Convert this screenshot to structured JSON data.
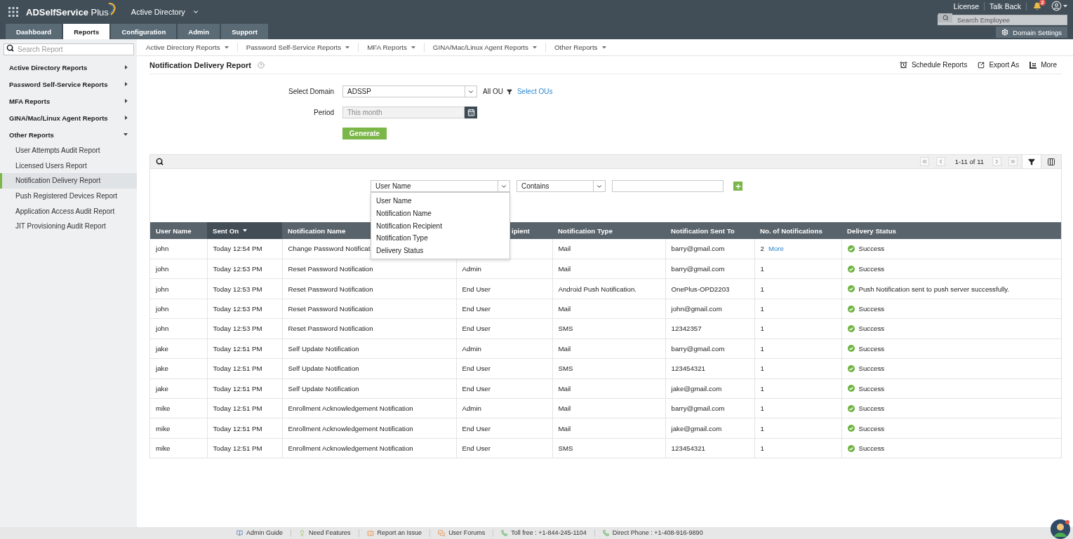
{
  "header": {
    "product_name": "**ADSelfService** Plus",
    "module": "Active Directory",
    "links": [
      "License",
      "Talk Back"
    ],
    "notification_count": "2",
    "employee_search": {
      "placeholder": "Search Employee"
    },
    "domain_settings": "Domain Settings"
  },
  "tabs": [
    {
      "label": "Dashboard",
      "selected": false
    },
    {
      "label": "Reports",
      "selected": true
    },
    {
      "label": "Configuration",
      "selected": false
    },
    {
      "label": "Admin",
      "selected": false
    },
    {
      "label": "Support",
      "selected": false
    }
  ],
  "report_search": {
    "placeholder": "Search Report"
  },
  "report_menu": [
    "Active Directory Reports",
    "Password Self-Service Reports",
    "MFA Reports",
    "GINA/Mac/Linux Agent Reports",
    "Other Reports"
  ],
  "sidebar": {
    "items": [
      {
        "label": "Active Directory Reports",
        "expanded": false
      },
      {
        "label": "Password Self-Service Reports",
        "expanded": false
      },
      {
        "label": "MFA Reports",
        "expanded": false
      },
      {
        "label": "GINA/Mac/Linux Agent Reports",
        "expanded": false
      },
      {
        "label": "Other Reports",
        "expanded": true,
        "children": [
          {
            "label": "User Attempts Audit Report",
            "selected": false
          },
          {
            "label": "Licensed Users Report",
            "selected": false
          },
          {
            "label": "Notification Delivery Report",
            "selected": true
          },
          {
            "label": "Push Registered Devices Report",
            "selected": false
          },
          {
            "label": "Application Access Audit Report",
            "selected": false
          },
          {
            "label": "JIT Provisioning Audit Report",
            "selected": false
          }
        ]
      }
    ]
  },
  "report": {
    "title": "Notification Delivery Report",
    "actions": [
      {
        "label": "Schedule Reports",
        "kind": "schedule"
      },
      {
        "label": "Export As",
        "kind": "export"
      },
      {
        "label": "More",
        "kind": "more"
      }
    ]
  },
  "form": {
    "domain_label": "Select Domain",
    "domain": "ADSSP",
    "ou_scope": "All OU",
    "select_ous_link": "Select OUs",
    "period_label": "Period",
    "period": "This month",
    "generate_button": "Generate"
  },
  "table": {
    "page_info": "1-11 of 11",
    "filter": {
      "open": true,
      "field": "User Name",
      "field_menu_expanded": true,
      "field_options": [
        {
          "label": "User Name",
          "selected": false
        },
        {
          "label": "Notification Name",
          "selected": false
        },
        {
          "label": "Notification Recipient",
          "selected": false
        },
        {
          "label": "Notification Type",
          "selected": false
        },
        {
          "label": "Delivery Status",
          "selected": false
        }
      ],
      "operator": "Contains"
    },
    "columns": [
      {
        "label": "User Name",
        "sorted": false
      },
      {
        "label": "Sent On",
        "sorted": true
      },
      {
        "label": "Notification Name",
        "sorted": false
      },
      {
        "label": "ipient",
        "sorted": false
      },
      {
        "label": "Notification Type",
        "sorted": false
      },
      {
        "label": "Notification Sent To",
        "sorted": false
      },
      {
        "label": "No. of Notifications",
        "sorted": false
      },
      {
        "label": "Delivery Status",
        "sorted": false
      }
    ],
    "rows": [
      {
        "user_name": "john",
        "sent_on": "Today 12:54 PM",
        "notification_name": "Change Password Notificat",
        "notification_type": "Mail",
        "sent_to": "barry@gmail.com",
        "notifications": "2",
        "more_link": "More",
        "status": "Success"
      },
      {
        "user_name": "john",
        "sent_on": "Today 12:53 PM",
        "notification_name": "Reset Password Notification",
        "column_4": "Admin",
        "notification_type": "Mail",
        "sent_to": "barry@gmail.com",
        "notifications": "1",
        "status": "Success"
      },
      {
        "user_name": "john",
        "sent_on": "Today 12:53 PM",
        "notification_name": "Reset Password Notification",
        "column_4": "End User",
        "notification_type": "Android Push Notification.",
        "sent_to": "OnePlus-OPD2203",
        "notifications": "1",
        "status": "Push Notification sent to push server successfully."
      },
      {
        "user_name": "john",
        "sent_on": "Today 12:53 PM",
        "notification_name": "Reset Password Notification",
        "column_4": "End User",
        "notification_type": "Mail",
        "sent_to": "john@gmail.com",
        "notifications": "1",
        "status": "Success"
      },
      {
        "user_name": "john",
        "sent_on": "Today 12:53 PM",
        "notification_name": "Reset Password Notification",
        "column_4": "End User",
        "notification_type": "SMS",
        "sent_to": "12342357",
        "notifications": "1",
        "status": "Success"
      },
      {
        "user_name": "jake",
        "sent_on": "Today 12:51 PM",
        "notification_name": "Self Update Notification",
        "column_4": "Admin",
        "notification_type": "Mail",
        "sent_to": "barry@gmail.com",
        "notifications": "1",
        "status": "Success"
      },
      {
        "user_name": "jake",
        "sent_on": "Today 12:51 PM",
        "notification_name": "Self Update Notification",
        "column_4": "End User",
        "notification_type": "SMS",
        "sent_to": "123454321",
        "notifications": "1",
        "status": "Success"
      },
      {
        "user_name": "jake",
        "sent_on": "Today 12:51 PM",
        "notification_name": "Self Update Notification",
        "column_4": "End User",
        "notification_type": "Mail",
        "sent_to": "jake@gmail.com",
        "notifications": "1",
        "status": "Success"
      },
      {
        "user_name": "mike",
        "sent_on": "Today 12:51 PM",
        "notification_name": "Enrollment Acknowledgement Notification",
        "column_4": "Admin",
        "notification_type": "Mail",
        "sent_to": "barry@gmail.com",
        "notifications": "1",
        "status": "Success"
      },
      {
        "user_name": "mike",
        "sent_on": "Today 12:51 PM",
        "notification_name": "Enrollment Acknowledgement Notification",
        "column_4": "End User",
        "notification_type": "Mail",
        "sent_to": "jake@gmail.com",
        "notifications": "1",
        "status": "Success"
      },
      {
        "user_name": "mike",
        "sent_on": "Today 12:51 PM",
        "notification_name": "Enrollment Acknowledgement Notification",
        "column_4": "End User",
        "notification_type": "SMS",
        "sent_to": "123454321",
        "notifications": "1",
        "status": "Success"
      }
    ]
  },
  "footer": {
    "links": [
      {
        "label": "Admin Guide",
        "kind": "guide"
      },
      {
        "label": "Need Features",
        "kind": "idea"
      },
      {
        "label": "Report an Issue",
        "kind": "issue"
      },
      {
        "label": "User Forums",
        "kind": "forum"
      },
      {
        "label": "Toll free : +1-844-245-1104",
        "kind": "phone"
      },
      {
        "label": "Direct Phone : +1-408-916-9890",
        "kind": "phone"
      }
    ]
  }
}
